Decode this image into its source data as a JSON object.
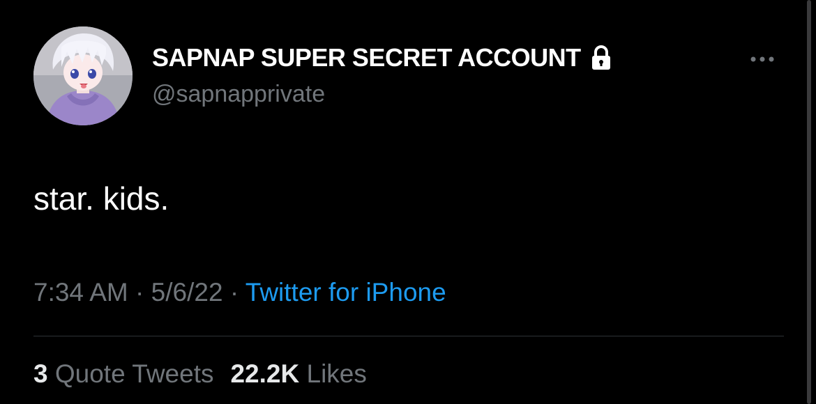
{
  "tweet": {
    "display_name": "SAPNAP SUPER SECRET ACCOUNT",
    "handle": "@sapnapprivate",
    "protected_icon": "lock-icon",
    "more_icon": "ellipsis-icon",
    "text": "star. kids.",
    "time": "7:34 AM",
    "separator": "·",
    "date": "5/6/22",
    "source": "Twitter for iPhone",
    "quote_tweets_count": "3",
    "quote_tweets_label": "Quote Tweets",
    "likes_count": "22.2K",
    "likes_label": "Likes"
  },
  "colors": {
    "background": "#000000",
    "primary_text": "#ffffff",
    "secondary_text": "#71767b",
    "link": "#1d9bf0",
    "divider": "#2f3336"
  }
}
